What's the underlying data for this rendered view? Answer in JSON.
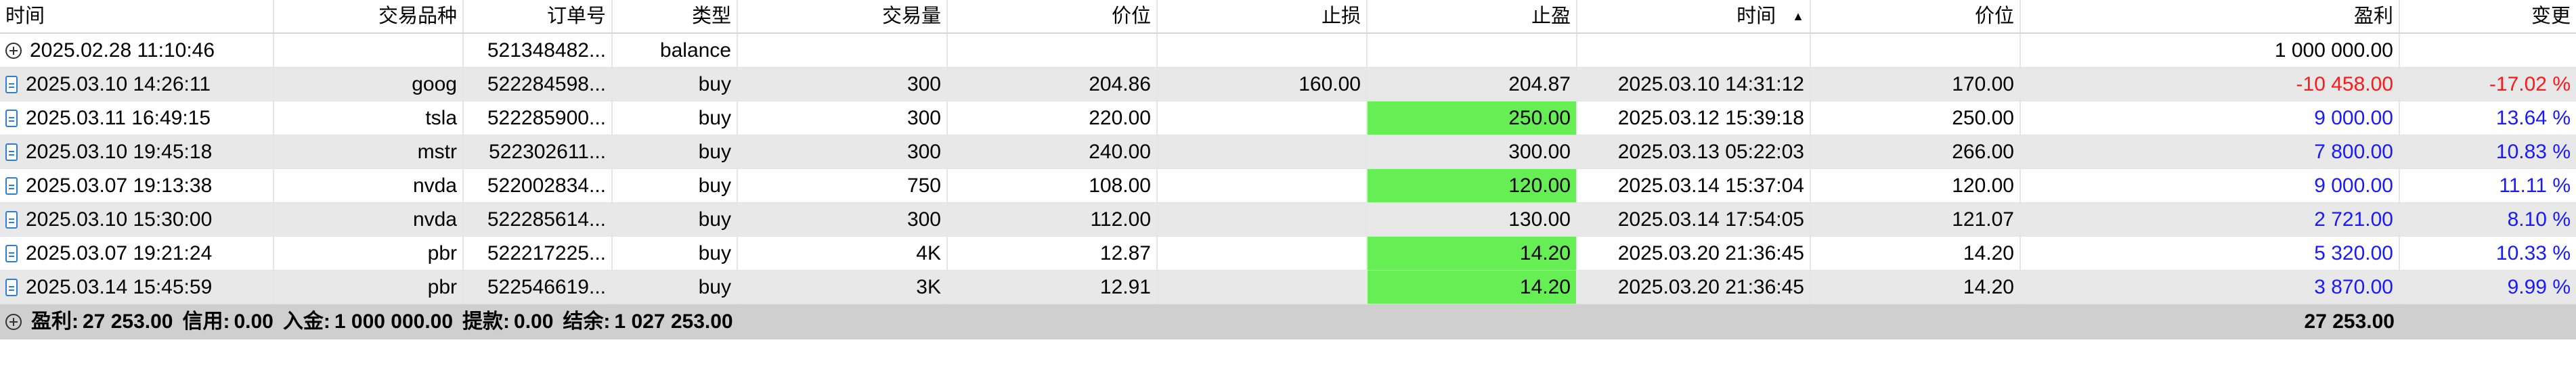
{
  "headers": [
    "时间",
    "交易品种",
    "订单号",
    "类型",
    "交易量",
    "价位",
    "止损",
    "止盈",
    "时间",
    "价位",
    "盈利",
    "变更"
  ],
  "sort_indicator": "▲",
  "balance_row": {
    "time": "2025.02.28 11:10:46",
    "symbol": "",
    "order": "521348482...",
    "type": "balance",
    "volume": "",
    "price": "",
    "sl": "",
    "tp": "",
    "close_time": "",
    "close_price": "",
    "profit": "1 000 000.00",
    "change": ""
  },
  "rows": [
    {
      "time": "2025.03.10 14:26:11",
      "symbol": "goog",
      "order": "522284598...",
      "type": "buy",
      "volume": "300",
      "price": "204.86",
      "sl": "160.00",
      "tp": "204.87",
      "tp_hit": false,
      "close_time": "2025.03.10 14:31:12",
      "close_price": "170.00",
      "profit": "-10 458.00",
      "change": "-17.02 %",
      "tone": "red"
    },
    {
      "time": "2025.03.11 16:49:15",
      "symbol": "tsla",
      "order": "522285900...",
      "type": "buy",
      "volume": "300",
      "price": "220.00",
      "sl": "",
      "tp": "250.00",
      "tp_hit": true,
      "close_time": "2025.03.12 15:39:18",
      "close_price": "250.00",
      "profit": "9 000.00",
      "change": "13.64 %",
      "tone": "blue"
    },
    {
      "time": "2025.03.10 19:45:18",
      "symbol": "mstr",
      "order": "522302611...",
      "type": "buy",
      "volume": "300",
      "price": "240.00",
      "sl": "",
      "tp": "300.00",
      "tp_hit": false,
      "close_time": "2025.03.13 05:22:03",
      "close_price": "266.00",
      "profit": "7 800.00",
      "change": "10.83 %",
      "tone": "blue"
    },
    {
      "time": "2025.03.07 19:13:38",
      "symbol": "nvda",
      "order": "522002834...",
      "type": "buy",
      "volume": "750",
      "price": "108.00",
      "sl": "",
      "tp": "120.00",
      "tp_hit": true,
      "close_time": "2025.03.14 15:37:04",
      "close_price": "120.00",
      "profit": "9 000.00",
      "change": "11.11 %",
      "tone": "blue"
    },
    {
      "time": "2025.03.10 15:30:00",
      "symbol": "nvda",
      "order": "522285614...",
      "type": "buy",
      "volume": "300",
      "price": "112.00",
      "sl": "",
      "tp": "130.00",
      "tp_hit": false,
      "close_time": "2025.03.14 17:54:05",
      "close_price": "121.07",
      "profit": "2 721.00",
      "change": "8.10 %",
      "tone": "blue"
    },
    {
      "time": "2025.03.07 19:21:24",
      "symbol": "pbr",
      "order": "522217225...",
      "type": "buy",
      "volume": "4K",
      "price": "12.87",
      "sl": "",
      "tp": "14.20",
      "tp_hit": true,
      "close_time": "2025.03.20 21:36:45",
      "close_price": "14.20",
      "profit": "5 320.00",
      "change": "10.33 %",
      "tone": "blue"
    },
    {
      "time": "2025.03.14 15:45:59",
      "symbol": "pbr",
      "order": "522546619...",
      "type": "buy",
      "volume": "3K",
      "price": "12.91",
      "sl": "",
      "tp": "14.20",
      "tp_hit": true,
      "close_time": "2025.03.20 21:36:45",
      "close_price": "14.20",
      "profit": "3 870.00",
      "change": "9.99 %",
      "tone": "blue"
    }
  ],
  "summary": {
    "profit_label": "盈利:",
    "profit": "27 253.00",
    "credit_label": "信用:",
    "credit": "0.00",
    "deposit_label": "入金:",
    "deposit": "1 000 000.00",
    "withdraw_label": "提款:",
    "withdraw": "0.00",
    "balance_label": "结余:",
    "balance": "1 027 253.00",
    "total_profit": "27 253.00"
  },
  "colors": {
    "tp_highlight": "#66ee55",
    "loss": "#ff1a1a",
    "gain": "#1a1aff",
    "row_alt": "#e8e8e8",
    "summary_bg": "#cfcfcf"
  },
  "icons": {
    "order_row": "document-icon",
    "balance_row": "expand-plus-icon",
    "sort": "sort-ascending-icon"
  }
}
